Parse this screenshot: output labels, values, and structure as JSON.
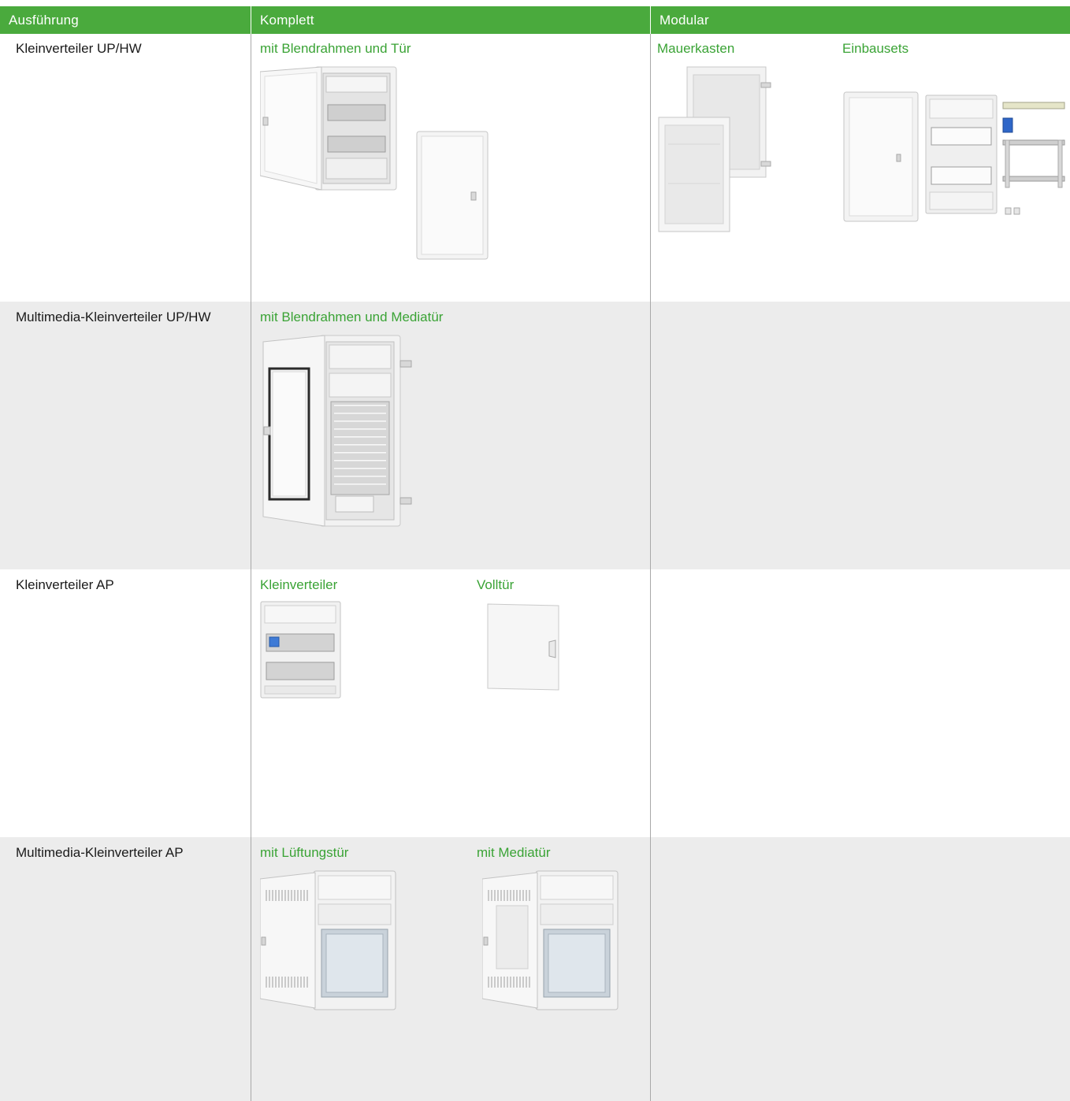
{
  "header": {
    "col1": "Ausführung",
    "col2": "Komplett",
    "col3": "Modular"
  },
  "rows": [
    {
      "label": "Kleinverteiler UP/HW",
      "komplett": [
        "mit Blendrahmen und Tür"
      ],
      "modular": [
        "Mauerkasten",
        "Einbausets"
      ]
    },
    {
      "label": "Multimedia-Kleinverteiler UP/HW",
      "komplett": [
        "mit Blendrahmen und Mediatür"
      ],
      "modular": []
    },
    {
      "label": "Kleinverteiler AP",
      "komplett": [
        "Kleinverteiler",
        "Volltür"
      ],
      "modular": []
    },
    {
      "label": "Multimedia-Kleinverteiler AP",
      "komplett": [
        "mit Lüftungstür",
        "mit Mediatür"
      ],
      "modular": []
    }
  ],
  "colors": {
    "header_bg": "#4aaa3d",
    "green_text": "#3aa335",
    "row_alt_bg": "#ececec",
    "divider": "#a8a8a8"
  }
}
